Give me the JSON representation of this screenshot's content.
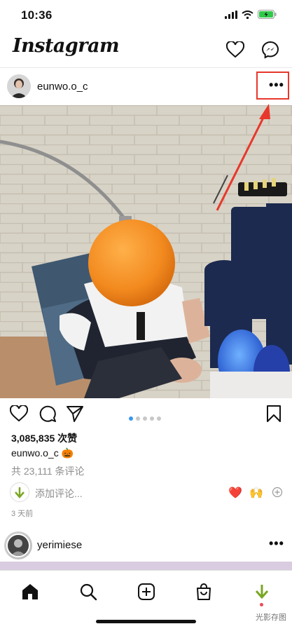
{
  "status_bar": {
    "time": "10:36"
  },
  "header": {
    "logo": "Instagram",
    "icons": [
      "heart-icon",
      "messenger-icon"
    ]
  },
  "post": {
    "username": "eunwo.o_c",
    "more_label": "•••",
    "carousel": {
      "count": 5,
      "active_index": 0
    },
    "likes": "3,085,835 次赞",
    "caption_user": "eunwo.o_c",
    "caption_emoji": "🎃",
    "comments_link": "共 23,111 条评论",
    "add_comment_placeholder": "添加评论...",
    "quick_reactions": [
      "❤️",
      "🙌"
    ],
    "time_ago": "3 天前"
  },
  "next_post": {
    "username": "yerimiese",
    "more_label": "•••"
  },
  "watermark": "光影存图",
  "colors": {
    "accent": "#3897f0",
    "highlight": "#e8372b",
    "lamp": "#f28a1f",
    "notification": "#ed4956"
  }
}
